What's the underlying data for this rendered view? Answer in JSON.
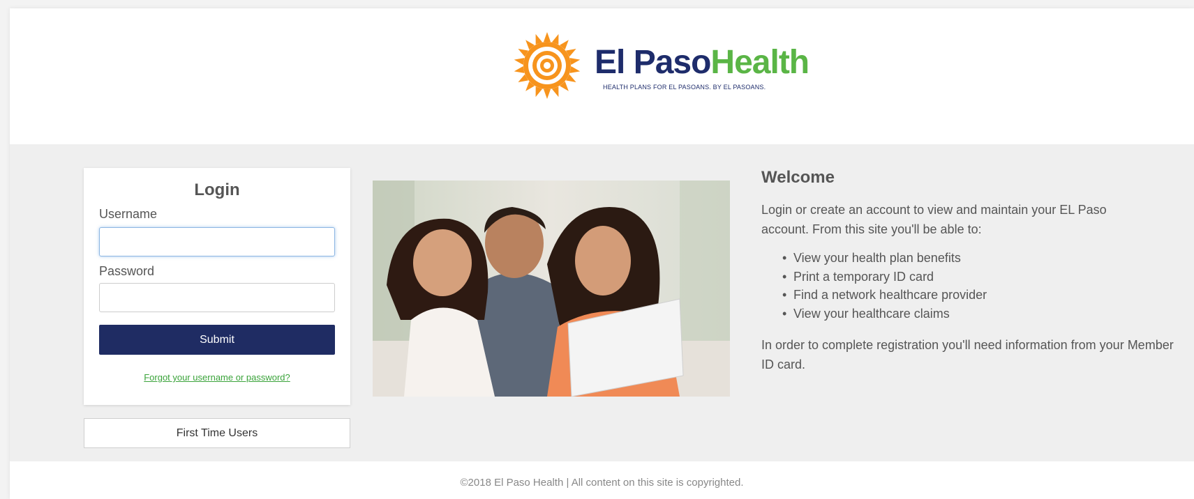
{
  "brand": {
    "name_part1": "El Paso",
    "name_part2": "Health",
    "tagline": "HEALTH PLANS FOR EL PASOANS. BY EL PASOANS.",
    "colors": {
      "navy": "#1e2c6b",
      "green": "#5ab546",
      "sun": "#f7941d"
    }
  },
  "login": {
    "title": "Login",
    "username_label": "Username",
    "username_value": "",
    "password_label": "Password",
    "password_value": "",
    "submit_label": "Submit",
    "forgot_link": "Forgot your username or password?"
  },
  "first_time_users_label": "First Time Users",
  "welcome": {
    "title": "Welcome",
    "intro": "Login or create an account to view and maintain your EL Paso account. From this site you'll be able to:",
    "benefits": [
      "View your health plan benefits",
      "Print a temporary ID card",
      "Find a network healthcare provider",
      "View your healthcare claims"
    ],
    "note": "In order to complete registration you'll need information from your Member ID card."
  },
  "footer": {
    "copyright": "©2018 El Paso Health | All content on this site is copyrighted."
  }
}
